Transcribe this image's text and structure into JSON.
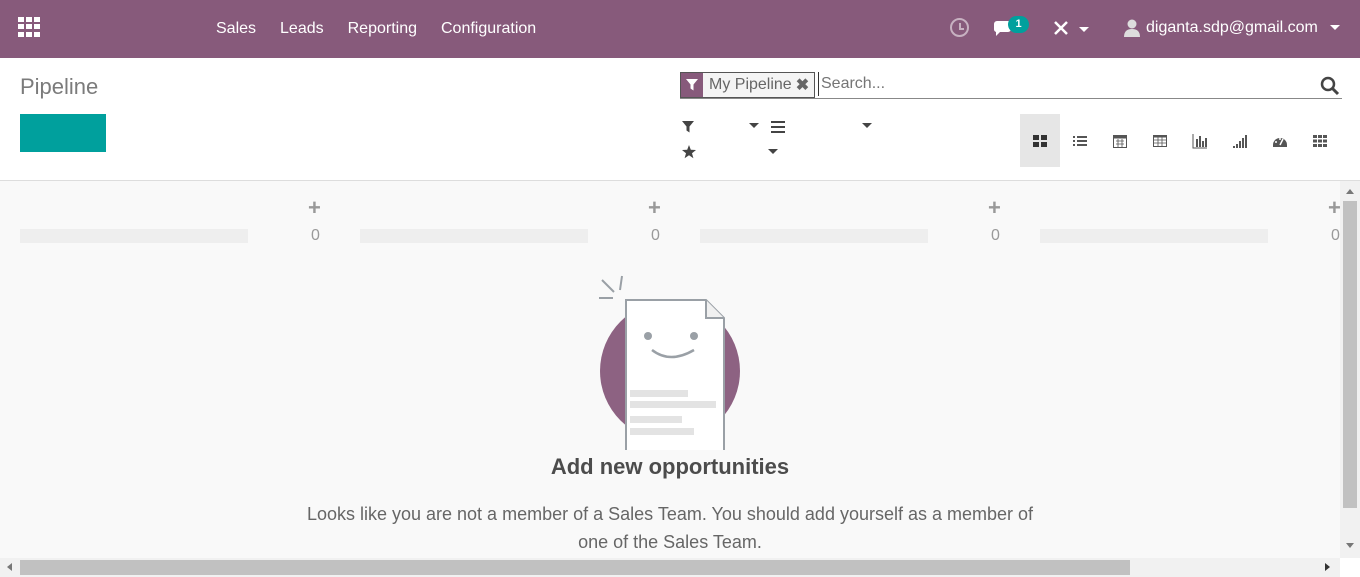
{
  "topbar": {
    "menu": [
      "Sales",
      "Leads",
      "Reporting",
      "Configuration"
    ],
    "chat_badge": "1",
    "user_name": "diganta.sdp@gmail.com"
  },
  "control": {
    "title": "Pipeline",
    "create_label": "",
    "search": {
      "facet_value": "My Pipeline",
      "placeholder": "Search..."
    }
  },
  "kanban": {
    "columns": [
      {
        "count": "0"
      },
      {
        "count": "0"
      },
      {
        "count": "0"
      },
      {
        "count": "0"
      }
    ]
  },
  "help": {
    "title": "Add new opportunities",
    "text": "Looks like you are not a member of a Sales Team. You should add yourself as a member of one of the Sales Team."
  },
  "colors": {
    "brand": "#875a7b",
    "accent": "#00a09d"
  }
}
